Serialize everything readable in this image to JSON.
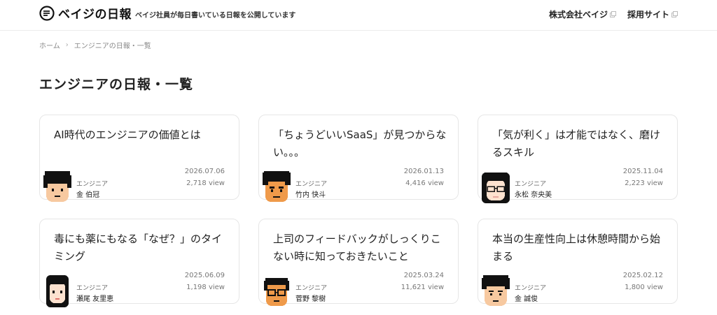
{
  "header": {
    "logo_text": "ベイジの日報",
    "tagline": "ベイジ社員が毎日書いている日報を公開しています",
    "nav": [
      {
        "label": "株式会社ベイジ"
      },
      {
        "label": "採用サイト"
      }
    ]
  },
  "breadcrumb": {
    "home": "ホーム",
    "current": "エンジニアの日報・一覧"
  },
  "page_title": "エンジニアの日報・一覧",
  "cards": [
    {
      "title": "AI時代のエンジニアの価値とは",
      "date": "2026.07.06",
      "views": "2,718 view",
      "role": "エンジニア",
      "author": "金 伯冠"
    },
    {
      "title": "「ちょうどいいSaaS」が見つからない。。。",
      "date": "2026.01.13",
      "views": "4,416 view",
      "role": "エンジニア",
      "author": "竹内 快斗"
    },
    {
      "title": "「気が利く」は才能ではなく、磨けるスキル",
      "date": "2025.11.04",
      "views": "2,223 view",
      "role": "エンジニア",
      "author": "永松 奈央美"
    },
    {
      "title": "毒にも薬にもなる「なぜ？」のタイミング",
      "date": "2025.06.09",
      "views": "1,198 view",
      "role": "エンジニア",
      "author": "瀬尾 友里恵"
    },
    {
      "title": "上司のフィードバックがしっくりこない時に知っておきたいこと",
      "date": "2025.03.24",
      "views": "11,621 view",
      "role": "エンジニア",
      "author": "菅野 黎樹"
    },
    {
      "title": "本当の生産性向上は休憩時間から始まる",
      "date": "2025.02.12",
      "views": "1,800 view",
      "role": "エンジニア",
      "author": "金 誠俊"
    }
  ],
  "colors": {
    "text": "#222222",
    "muted": "#777777",
    "border": "#e6e6e6",
    "skin": "#f7c9a0",
    "skin_tan": "#ef9a4a"
  }
}
